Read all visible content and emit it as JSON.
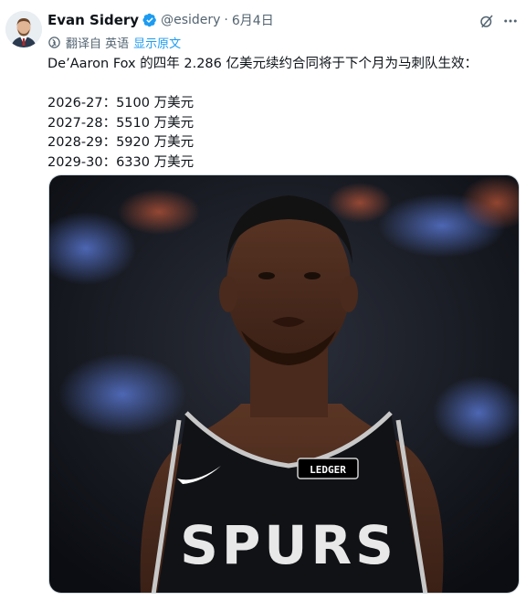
{
  "author": {
    "name": "Evan Sidery",
    "handle": "@esidery",
    "separator": "·",
    "date": "6月4日"
  },
  "translation": {
    "note": "翻译自 英语",
    "show_original": "显示原文"
  },
  "tweet": {
    "intro": "De’Aaron Fox 的四年 2.286 亿美元续约合同将于下个月为马刺队生效：",
    "lines": [
      "2026-27：5100 万美元",
      "2027-28：5510 万美元",
      "2028-29：5920 万美元",
      "2029-30：6330 万美元"
    ]
  },
  "media": {
    "jersey_wordmark": "SPURS",
    "patch_text": "LEDGER"
  },
  "colors": {
    "accent": "#1d9bf0",
    "secondary_text": "#536471",
    "primary_text": "#0f1419"
  },
  "icons": [
    "verified-badge-icon",
    "translate-icon",
    "grok-icon",
    "more-icon"
  ]
}
